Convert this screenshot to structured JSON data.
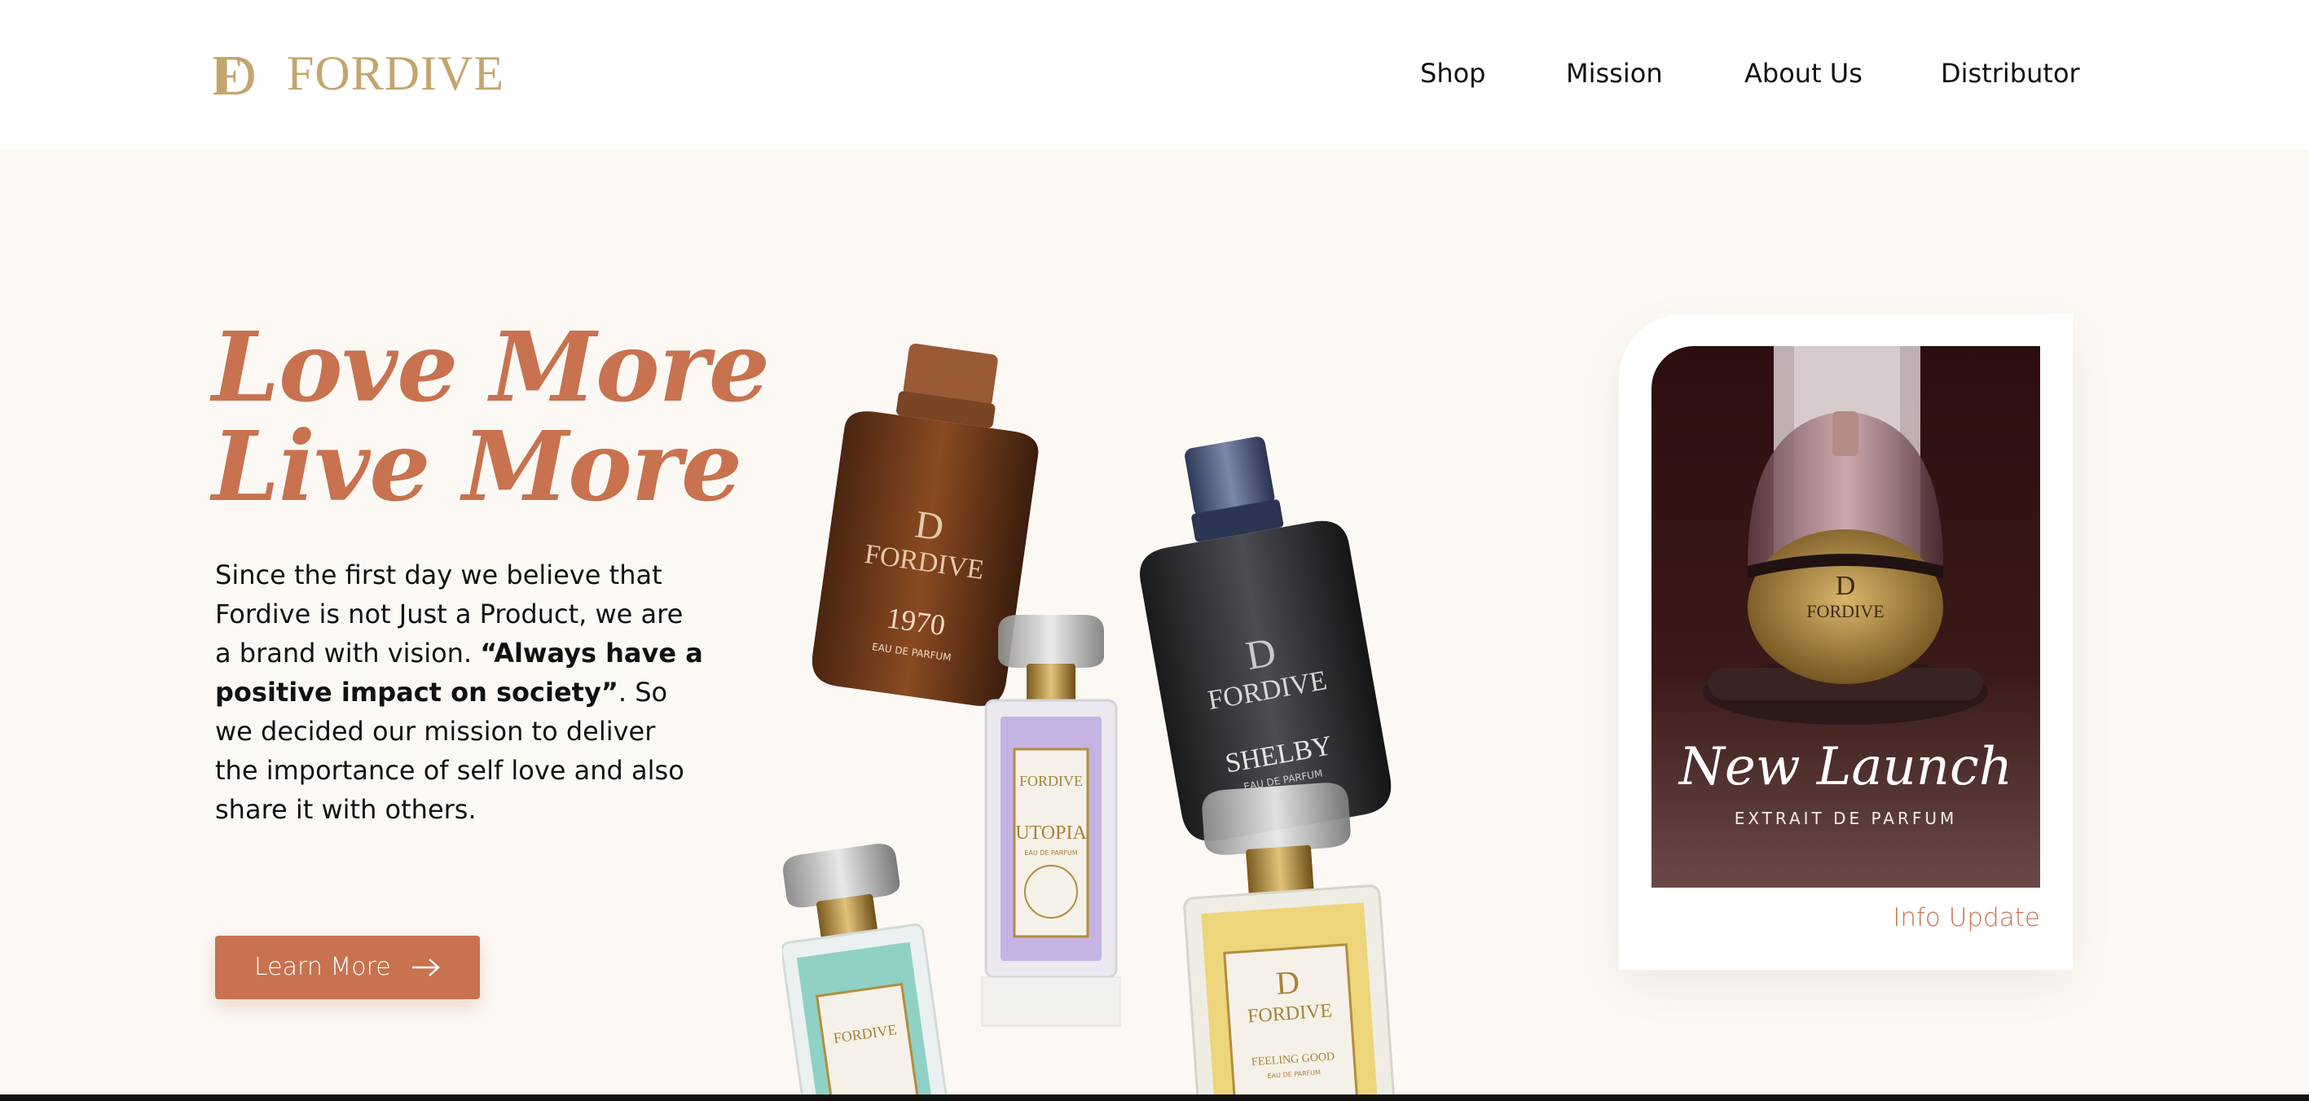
{
  "brand": {
    "name": "FORDIVE",
    "monogram": "FD"
  },
  "nav": {
    "items": [
      {
        "label": "Shop"
      },
      {
        "label": "Mission"
      },
      {
        "label": "About Us"
      },
      {
        "label": "Distributor"
      }
    ]
  },
  "hero": {
    "headline_line1": "Love More",
    "headline_line2": "Live More",
    "intro_part1": "Since the first day we believe that Fordive is not Just a Product, we are a brand with vision. ",
    "intro_quote": "“Always have a positive impact on society”",
    "intro_part2": ". So we decided our mission to deliver the importance of self love and also share it with others.",
    "cta_label": "Learn More",
    "cta_icon": "arrow-right-icon"
  },
  "bottles": [
    {
      "brand": "FORDIVE",
      "name": "1970",
      "sub": "EAU DE PARFUM"
    },
    {
      "brand": "FORDIVE",
      "name": "SHELBY",
      "sub": "EAU DE PARFUM"
    },
    {
      "brand": "FORDIVE",
      "name": "UTOPIA",
      "sub": "EAU DE PARFUM"
    },
    {
      "brand": "FORDIVE",
      "name": "FEELING GOOD",
      "sub": "EAU DE PARFUM"
    },
    {
      "brand": "FORDIVE",
      "name": "",
      "sub": ""
    }
  ],
  "card": {
    "title": "New Launch",
    "subtitle": "EXTRAIT DE PARFUM",
    "bottle_brand": "FORDIVE",
    "link_label": "Info Update"
  },
  "colors": {
    "accent": "#c8724f",
    "gold": "#c6a46e",
    "background": "#fcf9f5"
  }
}
